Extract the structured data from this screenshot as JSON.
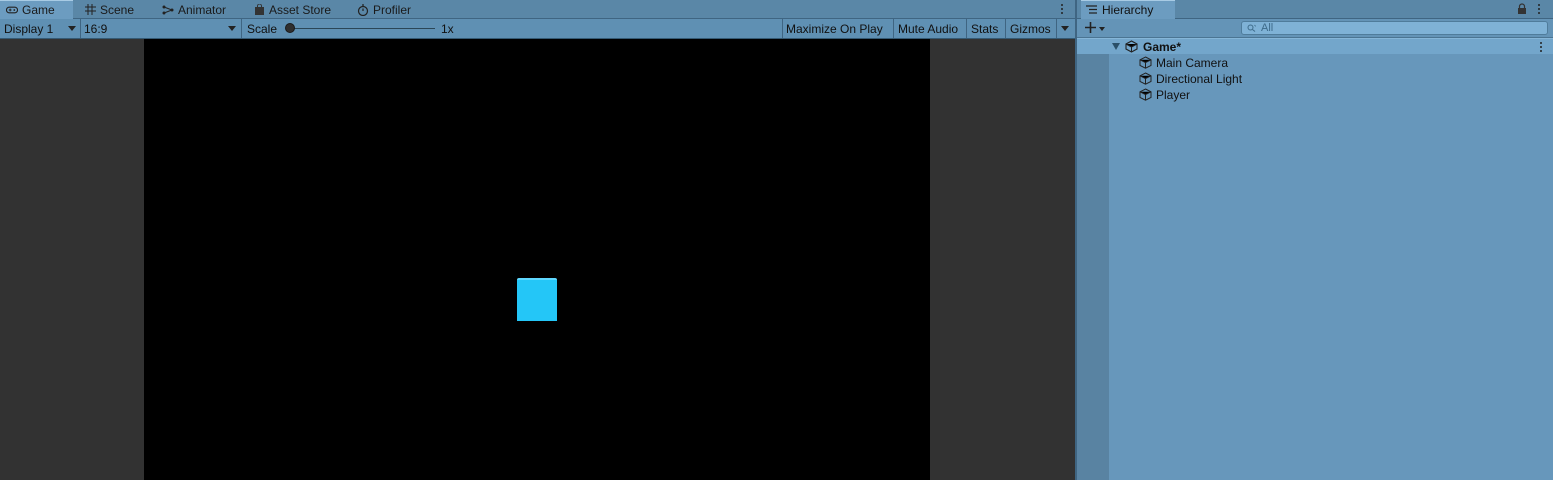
{
  "game_window": {
    "tabs": [
      {
        "label": "Game",
        "icon": "gamepad-icon",
        "active": true
      },
      {
        "label": "Scene",
        "icon": "grid-icon",
        "active": false
      },
      {
        "label": "Animator",
        "icon": "animator-icon",
        "active": false
      },
      {
        "label": "Asset Store",
        "icon": "bag-icon",
        "active": false
      },
      {
        "label": "Profiler",
        "icon": "stopwatch-icon",
        "active": false
      }
    ],
    "toolbar": {
      "display": "Display 1",
      "aspect": "16:9",
      "scale_label": "Scale",
      "scale_value": "1x",
      "scale_fraction": 0,
      "maximize_on_play": "Maximize On Play",
      "mute_audio": "Mute Audio",
      "stats": "Stats",
      "gizmos": "Gizmos"
    },
    "viewport": {
      "background": "#000000",
      "player_color": "#24c6f7"
    }
  },
  "hierarchy": {
    "tab_label": "Hierarchy",
    "search_placeholder": "All",
    "scene": {
      "name": "Game*",
      "expanded": true
    },
    "objects": [
      {
        "name": "Main Camera",
        "icon": "cube-icon"
      },
      {
        "name": "Directional Light",
        "icon": "cube-icon"
      },
      {
        "name": "Player",
        "icon": "cube-icon"
      }
    ]
  },
  "colors": {
    "panel_blue": "#6797bb",
    "toolbar_blue": "#5f90b3",
    "editor_dark": "#323232"
  }
}
